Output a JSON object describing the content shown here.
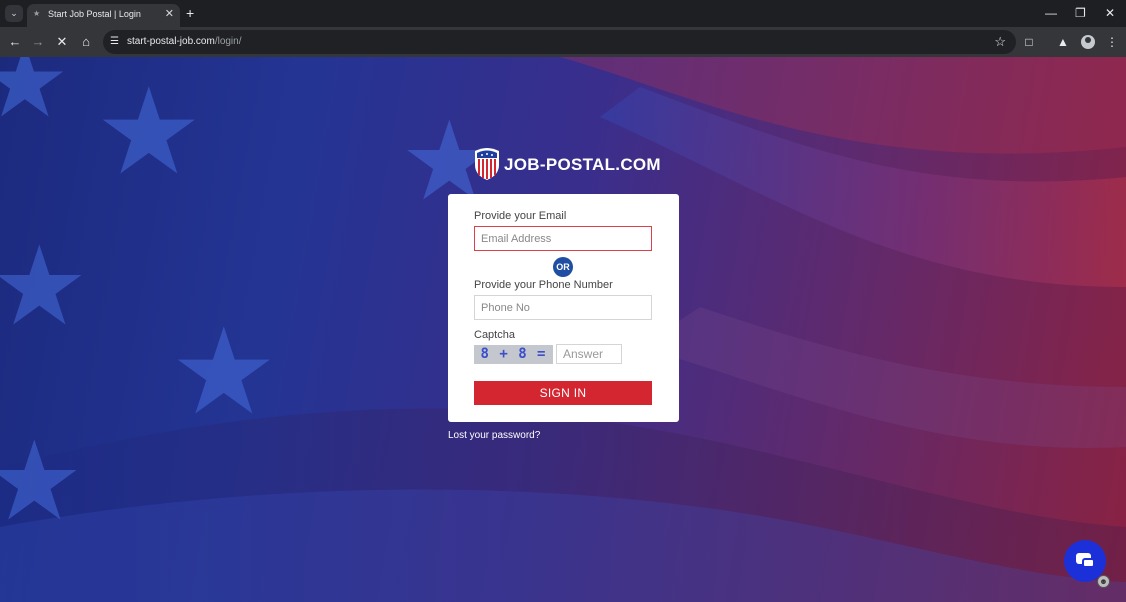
{
  "browser": {
    "tab": {
      "title": "Start Job Postal | Login",
      "favicon": "page-icon"
    },
    "new_tab_label": "+",
    "url": {
      "host": "start-postal-job.com",
      "path": "/login/"
    },
    "icons": {
      "tab_menu": "chevron-down-icon",
      "back": "back-arrow-icon",
      "forward": "forward-arrow-icon",
      "stop": "close-icon",
      "home": "home-icon",
      "site_info": "tune-icon",
      "bookmark": "star-icon",
      "extensions": "puzzle-icon",
      "labs": "flask-icon",
      "profile": "avatar-icon",
      "menu": "kebab-menu-icon",
      "minimize": "minimize-icon",
      "restore": "restore-icon",
      "close": "close-icon"
    }
  },
  "page": {
    "logo_text": "JOB-POSTAL.COM",
    "form": {
      "email_label": "Provide your Email",
      "email_placeholder": "Email Address",
      "or_label": "OR",
      "phone_label": "Provide your Phone Number",
      "phone_placeholder": "Phone No",
      "captcha_label": "Captcha",
      "captcha_question": "8 + 8 =",
      "captcha_placeholder": "Answer",
      "submit_label": "SIGN IN"
    },
    "lost_password_link": "Lost your password?",
    "chat_icon": "chat-bubble-icon"
  },
  "colors": {
    "accent_red": "#d42631",
    "or_badge": "#1f4ea3",
    "chat_button": "#1c30d9",
    "email_error_border": "#d9424b"
  }
}
